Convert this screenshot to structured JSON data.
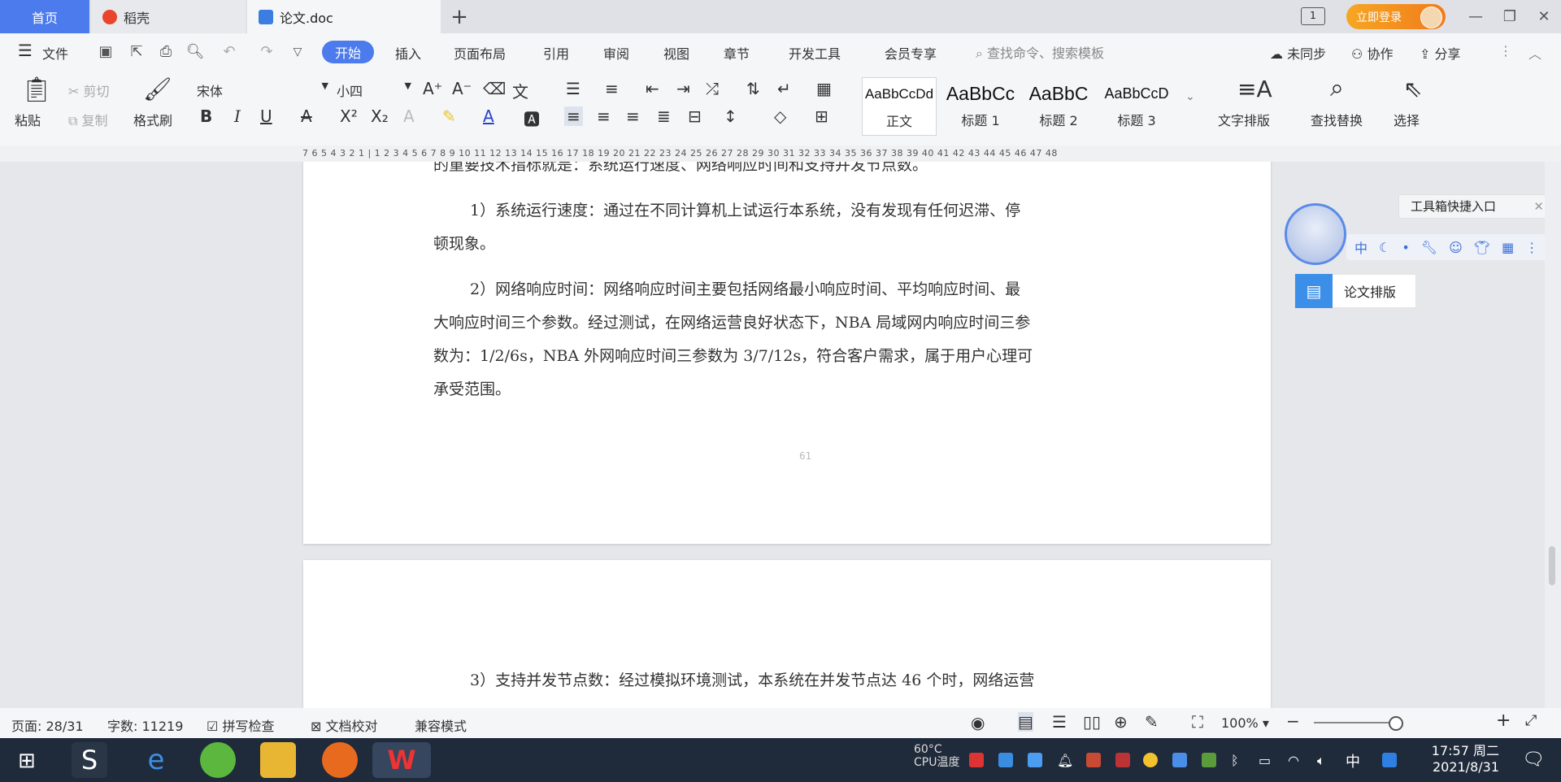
{
  "tabs": {
    "home": "首页",
    "daoke": "稻壳",
    "doc": "论文.doc"
  },
  "titlebar": {
    "login": "立即登录"
  },
  "menus": {
    "file": "文件",
    "start": "开始",
    "insert": "插入",
    "layout": "页面布局",
    "reference": "引用",
    "review": "审阅",
    "view": "视图",
    "chapter": "章节",
    "dev": "开发工具",
    "member": "会员专享",
    "search": "查找命令、搜索模板",
    "sync": "未同步",
    "collab": "协作",
    "share": "分享"
  },
  "ribbon": {
    "paste": "粘贴",
    "cut": "剪切",
    "copy": "复制",
    "format_painter": "格式刷",
    "font_name": "宋体",
    "font_size": "小四",
    "styles": [
      {
        "preview": "AaBbCcDd",
        "label": "正文"
      },
      {
        "preview": "AaBbCc",
        "label": "标题 1"
      },
      {
        "preview": "AaBbC",
        "label": "标题 2"
      },
      {
        "preview": "AaBbCcD",
        "label": "标题 3"
      }
    ],
    "text_layout": "文字排版",
    "find_replace": "查找替换",
    "select": "选择"
  },
  "ruler": "7 6 5 4 3 2 1 | 1 2 3 4 5 6 7 8 9 10 11 12 13 14 15 16 17 18 19 20 21 22 23 24 25 26 27 28 29 30 31 32 33 34 35 36 37 38 39 40 41 42 43 44 45 46 47 48",
  "document": {
    "p0": "的重要技术指标就是：系统运行速度、网络响应时间和支持并发节点数。",
    "p1a": "1）系统运行速度：通过在不同计算机上试运行本系统，没有发现有任何迟滞、停",
    "p1b": "顿现象。",
    "p2a": "2）网络响应时间：网络响应时间主要包括网络最小响应时间、平均响应时间、最",
    "p2b": "大响应时间三个参数。经过测试，在网络运营良好状态下，NBA 局域网内响应时间三参",
    "p2c": "数为：1/2/6s，NBA 外网响应时间三参数为 3/7/12s，符合客户需求，属于用户心理可",
    "p2d": "承受范围。",
    "page_number": "61",
    "p3": "3）支持并发节点数：经过模拟环境测试，本系统在并发节点达 46 个时，网络运营"
  },
  "side_panel": {
    "toolbox": "工具箱快捷入口",
    "strip_zh": "中",
    "thesis": "论文排版"
  },
  "status": {
    "page": "页面: 28/31",
    "words": "字数: 11219",
    "spell": "拼写检查",
    "proof": "文档校对",
    "compat": "兼容模式",
    "zoom": "100%"
  },
  "taskbar": {
    "cpu_temp": "60°C",
    "cpu_label": "CPU温度",
    "ime": "中",
    "time": "17:57 周二",
    "date": "2021/8/31"
  },
  "colors": {
    "accent": "#4b7bec",
    "login": "#f17b1b",
    "taskbar": "#1f2a3a"
  }
}
